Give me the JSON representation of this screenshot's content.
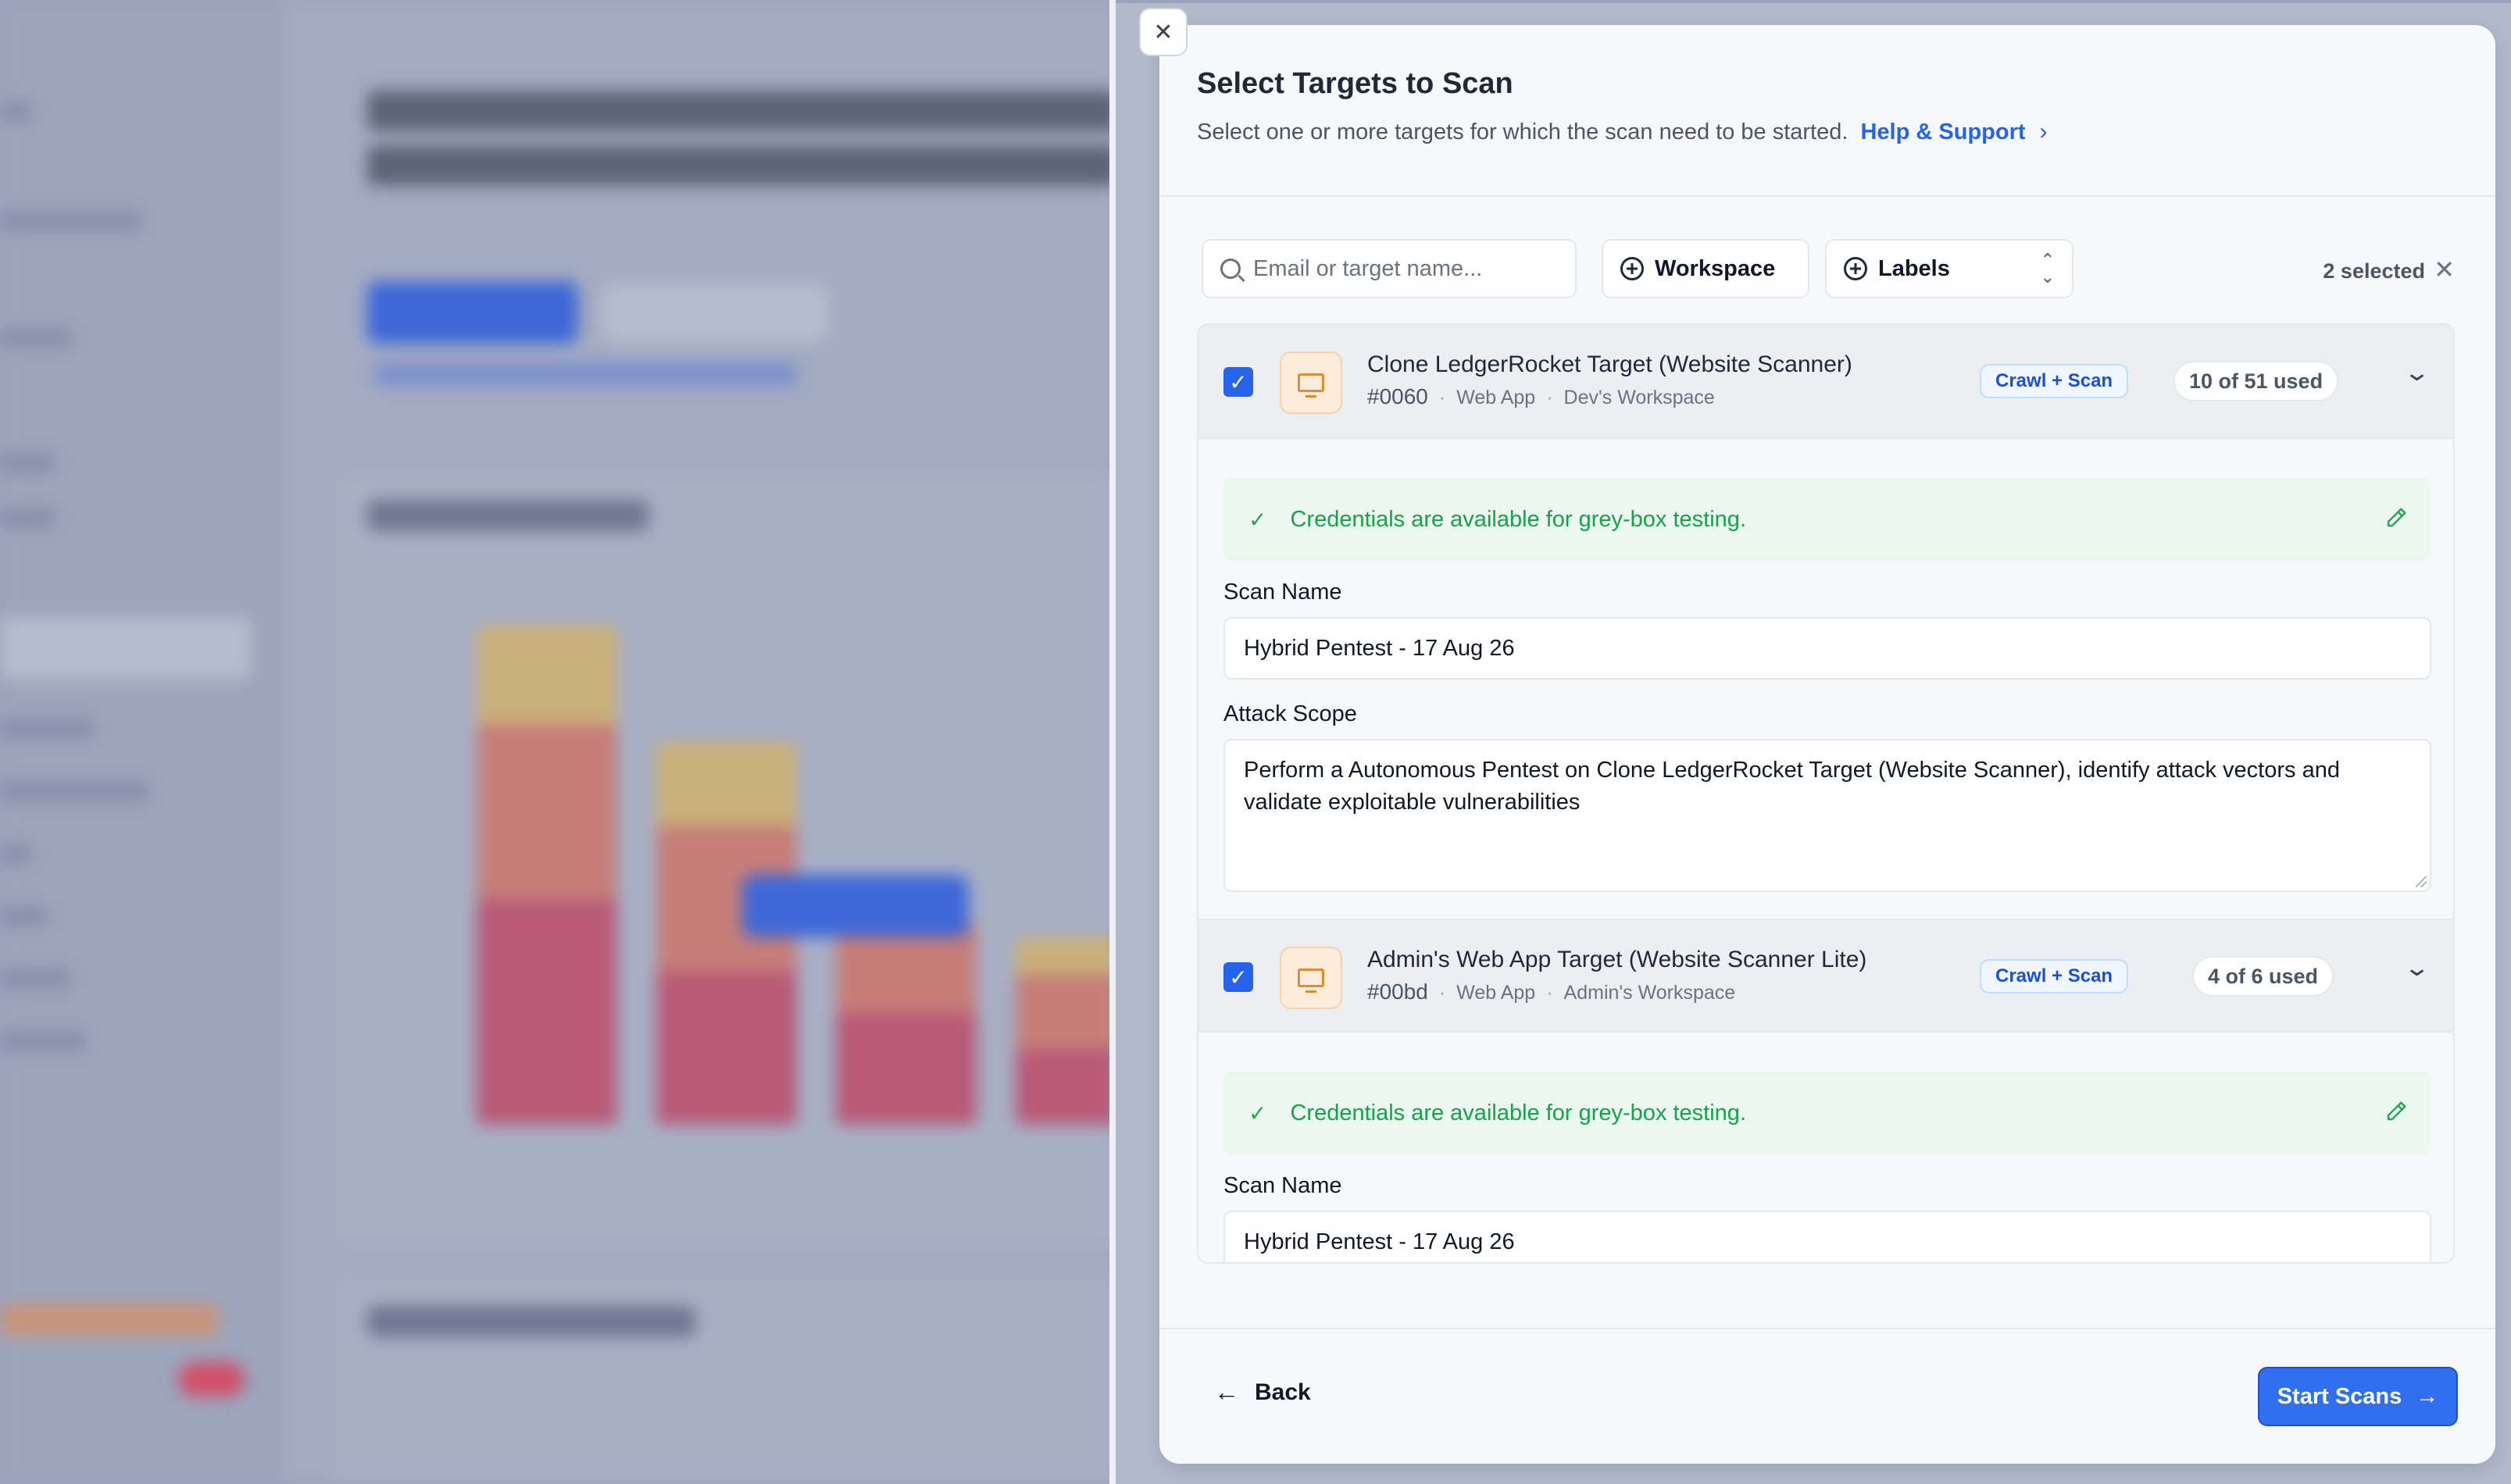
{
  "modal": {
    "title": "Select Targets to Scan",
    "subtitle": "Select one or more targets for which the scan need to be started.",
    "help_link": "Help & Support"
  },
  "filters": {
    "search_placeholder": "Email or target name...",
    "workspace_label": "Workspace",
    "labels_label": "Labels",
    "selected_count": "2 selected"
  },
  "targets": [
    {
      "checked": true,
      "name": "Clone LedgerRocket Target (Website Scanner)",
      "id": "#0060",
      "type": "Web App",
      "workspace": "Dev's Workspace",
      "badge": "Crawl + Scan",
      "usage": "10 of 51 used",
      "credentials_text": "Credentials are available for grey-box testing.",
      "scan_name_label": "Scan Name",
      "scan_name_value": "Hybrid Pentest - 17 Aug 26",
      "attack_scope_label": "Attack Scope",
      "attack_scope_value": "Perform a Autonomous Pentest on Clone LedgerRocket Target (Website Scanner), identify attack vectors and validate exploitable vulnerabilities"
    },
    {
      "checked": true,
      "name": "Admin's Web App Target (Website Scanner Lite)",
      "id": "#00bd",
      "type": "Web App",
      "workspace": "Admin's Workspace",
      "badge": "Crawl + Scan",
      "usage": "4 of 6 used",
      "credentials_text": "Credentials are available for grey-box testing.",
      "scan_name_label": "Scan Name",
      "scan_name_value": "Hybrid Pentest - 17 Aug 26"
    }
  ],
  "footer": {
    "back_label": "Back",
    "start_label": "Start Scans"
  },
  "colors": {
    "accent": "#2563eb",
    "success": "#16a34a",
    "app_icon": "#e58a2e"
  }
}
